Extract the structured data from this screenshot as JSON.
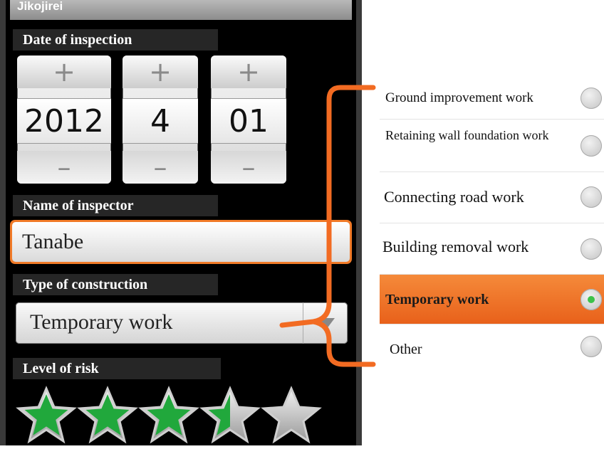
{
  "app": {
    "title": "Jikojirei"
  },
  "date_section": {
    "label": "Date of inspection",
    "year": "2012",
    "month": "4",
    "day": "01",
    "plus_symbol": "+",
    "minus_symbol": "–"
  },
  "inspector_section": {
    "label": "Name of inspector",
    "value": "Tanabe"
  },
  "construction_section": {
    "label": "Type of construction",
    "selected": "Temporary work"
  },
  "risk_section": {
    "label": "Level of risk",
    "rating": 3.5,
    "max": 5
  },
  "construction_options": [
    {
      "label": "Ground improvement work",
      "selected": false
    },
    {
      "label": "Retaining wall foundation work",
      "selected": false
    },
    {
      "label": "Connecting road work",
      "selected": false
    },
    {
      "label": "Building removal work",
      "selected": false
    },
    {
      "label": "Temporary work",
      "selected": true
    },
    {
      "label": "Other",
      "selected": false
    }
  ],
  "colors": {
    "accent": "#f07a28",
    "callout": "#f26b22",
    "star_fill": "#21a83c",
    "radio_selected": "#3cc24a"
  }
}
